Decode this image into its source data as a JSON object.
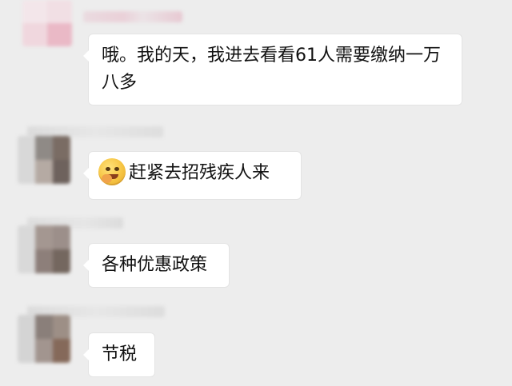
{
  "chat": {
    "messages": [
      {
        "text": "哦。我的天，我进去看看61人需要缴纳一万八多",
        "has_emoji": false
      },
      {
        "text": "赶紧去招残疾人来",
        "has_emoji": true,
        "emoji_icon": "grinning-face-icon"
      },
      {
        "text": "各种优惠政策",
        "has_emoji": false
      },
      {
        "text": "节税",
        "has_emoji": false
      }
    ]
  },
  "colors": {
    "background": "#ededed",
    "bubble": "#ffffff",
    "text": "#111111"
  }
}
